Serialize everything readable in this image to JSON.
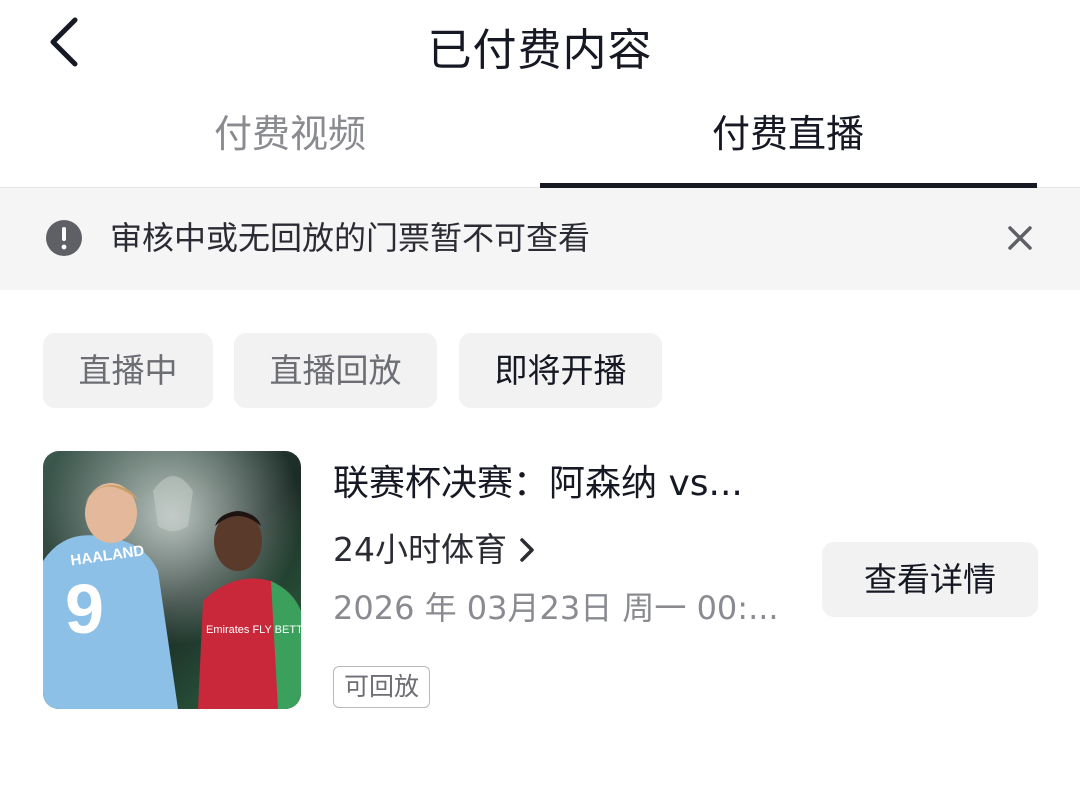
{
  "nav": {
    "title": "已付费内容",
    "back_icon": "chevron-left-icon"
  },
  "tabs": [
    {
      "label": "付费视频",
      "active": false
    },
    {
      "label": "付费直播",
      "active": true
    }
  ],
  "notice": {
    "icon": "exclamation-circle-icon",
    "text": "审核中或无回放的门票暂不可查看",
    "close_icon": "close-icon"
  },
  "filters": [
    {
      "label": "直播中",
      "selected": false
    },
    {
      "label": "直播回放",
      "selected": false
    },
    {
      "label": "即将开播",
      "selected": true
    }
  ],
  "items": [
    {
      "title": "联赛杯决赛：阿森纳 vs...",
      "channel": "24小时体育",
      "time": "2026 年 03月23日 周一 00:...",
      "tag": "可回放",
      "action": "查看详情",
      "cover_text": {
        "player_name": "HAALAND",
        "number": "9",
        "sponsor": "Emirates FLY BETTER"
      }
    }
  ],
  "colors": {
    "text_primary": "#161823",
    "text_secondary": "#8a8b91",
    "chip_bg": "#f2f2f3",
    "notice_bg": "#f5f5f6"
  }
}
